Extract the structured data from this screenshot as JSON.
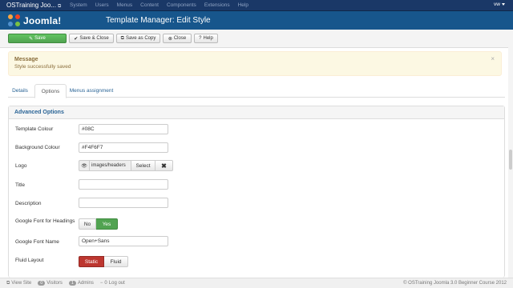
{
  "topnav": {
    "site_name": "OSTraining Joo...",
    "menu": [
      "System",
      "Users",
      "Menus",
      "Content",
      "Components",
      "Extensions",
      "Help"
    ],
    "user": "vw"
  },
  "header": {
    "logo_text": "Joomla!",
    "title": "Template Manager: Edit Style"
  },
  "toolbar": {
    "save": "Save",
    "save_close": "Save & Close",
    "save_copy": "Save as Copy",
    "close": "Close",
    "help": "Help"
  },
  "message": {
    "heading": "Message",
    "text": "Style successfully saved",
    "close": "×"
  },
  "tabs": [
    "Details",
    "Options",
    "Menus assignment"
  ],
  "panel": {
    "title": "Advanced Options",
    "fields": {
      "template_colour": {
        "label": "Template Colour",
        "value": "#08C"
      },
      "background_colour": {
        "label": "Background Colour",
        "value": "#F4F6F7"
      },
      "logo": {
        "label": "Logo",
        "value": "images/headers",
        "select": "Select",
        "clear": "✖"
      },
      "title": {
        "label": "Title",
        "value": ""
      },
      "description": {
        "label": "Description",
        "value": ""
      },
      "google_font_headings": {
        "label": "Google Font for Headings",
        "no": "No",
        "yes": "Yes",
        "selected": "Yes"
      },
      "google_font_name": {
        "label": "Google Font Name",
        "value": "Open+Sans"
      },
      "fluid_layout": {
        "label": "Fluid Layout",
        "static": "Static",
        "fluid": "Fluid",
        "selected": "Static"
      }
    }
  },
  "statusbar": {
    "view_site": "View Site",
    "visitors_count": "0",
    "visitors": "Visitors",
    "admins_count": "1",
    "admins": "Admins",
    "logout_count": "0",
    "logout": "Log out",
    "copyright": "© OSTraining Joomla 3.0 Beginner Course 2012"
  },
  "colors": {
    "nav_bg": "#1a3867",
    "header_bg": "#17568c",
    "save_green": "#51a351",
    "static_red": "#bd362f",
    "message_bg": "#fcf8e3"
  }
}
